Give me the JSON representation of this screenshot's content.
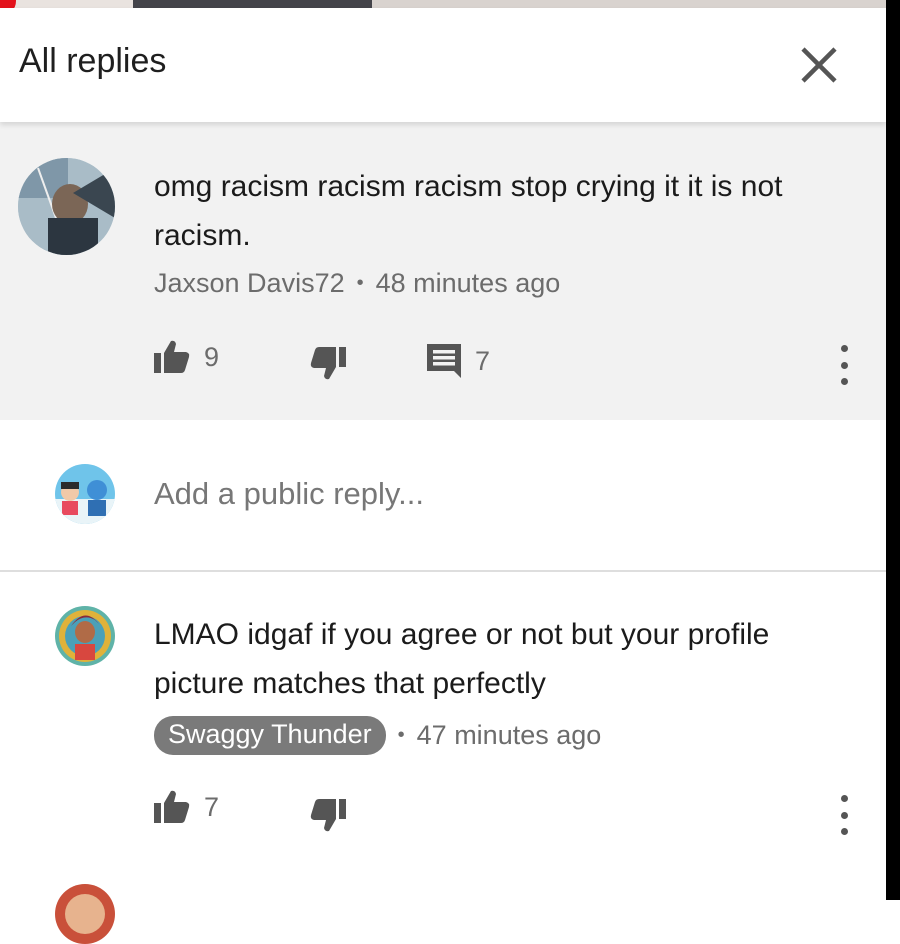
{
  "header": {
    "title": "All replies",
    "close_icon": "close-icon"
  },
  "parent_comment": {
    "text": "omg racism racism racism stop crying it it is not racism.",
    "author": "Jaxson Davis72",
    "time": "48 minutes ago",
    "likes": "9",
    "replies": "7"
  },
  "reply_box": {
    "placeholder": "Add a public reply..."
  },
  "replies": [
    {
      "text": "LMAO idgaf if you agree or not but your profile picture matches that perfectly",
      "author": "Swaggy Thunder",
      "time": "47 minutes ago",
      "likes": "7"
    }
  ],
  "colors": {
    "background_gray": "#f2f2f2",
    "icon_gray": "#555555",
    "author_pill": "#7a7a7a",
    "record_dot": "#e3121b"
  }
}
